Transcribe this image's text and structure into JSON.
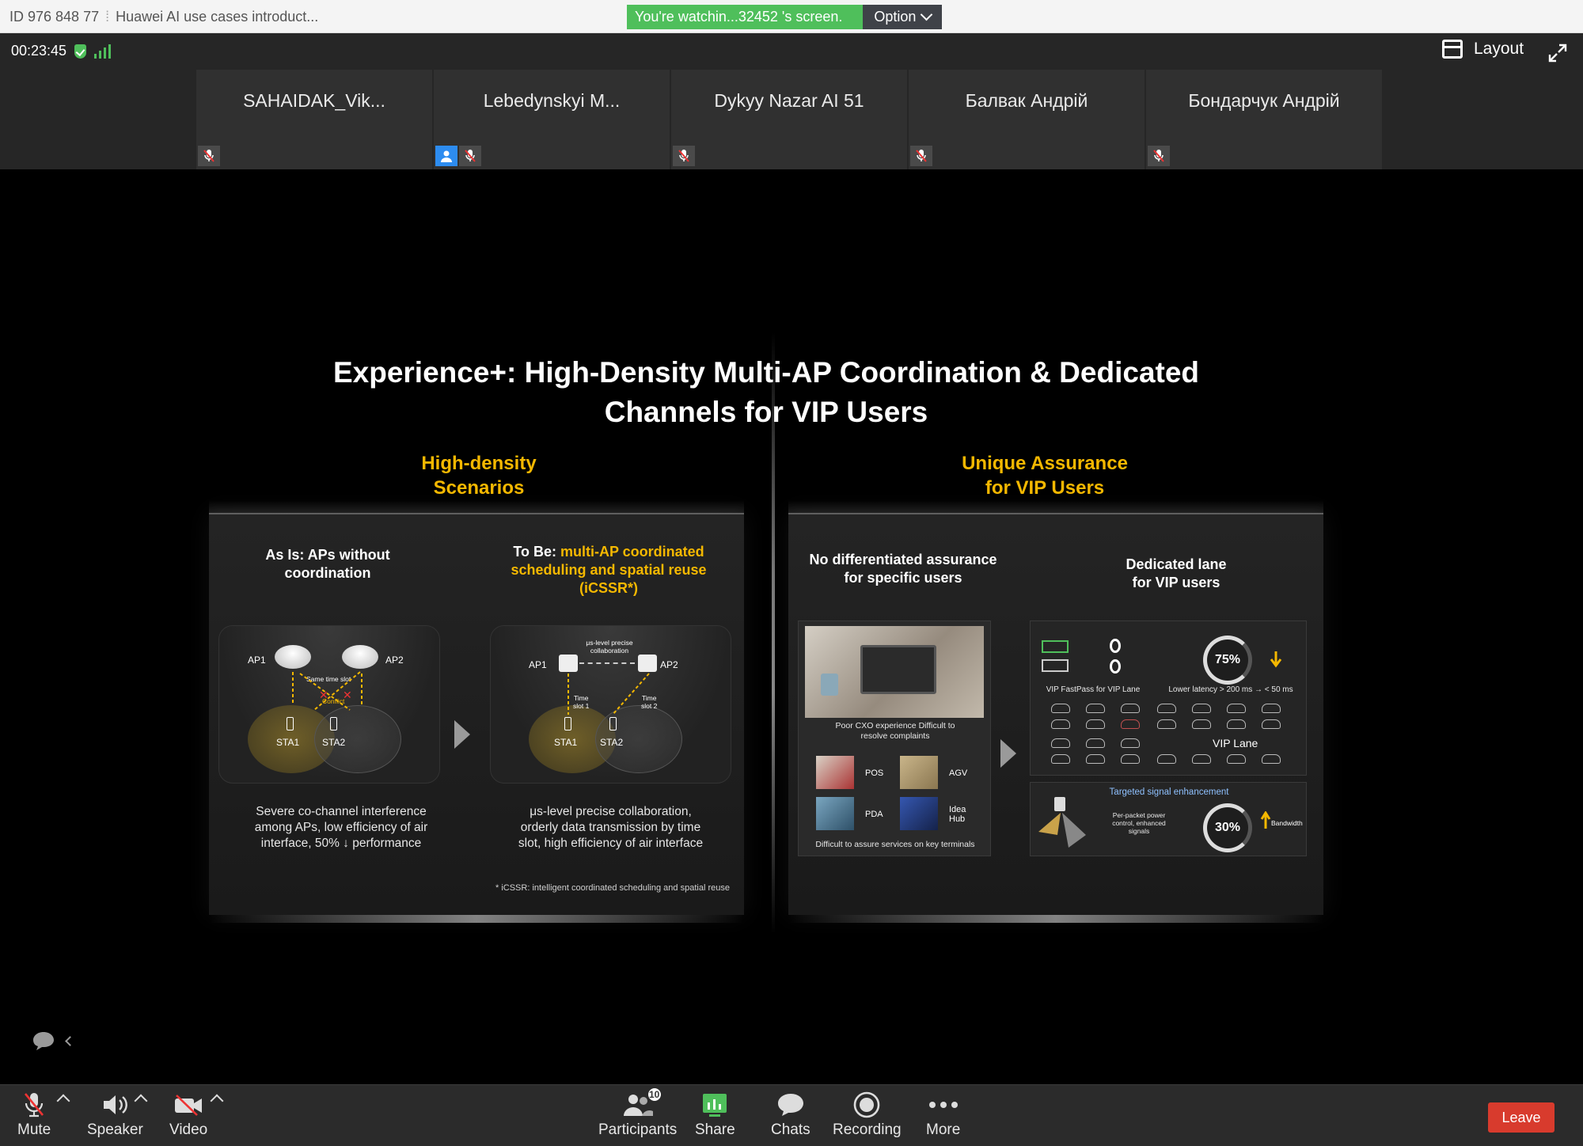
{
  "titlebar": {
    "meeting_id": "ID 976 848 77",
    "meeting_title": "Huawei AI use cases introduct...",
    "watching_message": "You're watchin...32452 's screen.",
    "option_label": "Option"
  },
  "status": {
    "timer": "00:23:45",
    "layout_label": "Layout"
  },
  "participants": [
    {
      "name": "SAHAIDAK_Vik...",
      "host": false
    },
    {
      "name": "Lebedynskyi M...",
      "host": true
    },
    {
      "name": "Dykyy Nazar AI 51",
      "host": false
    },
    {
      "name": "Балвак Андрій",
      "host": false
    },
    {
      "name": "Бондарчук Андрій",
      "host": false
    }
  ],
  "slide": {
    "title_line1": "Experience+: High-Density Multi-AP Coordination & Dedicated",
    "title_line2": "Channels for VIP Users",
    "left": {
      "head_line1": "High-density",
      "head_line2": "Scenarios",
      "asis_line1": "As Is: APs without",
      "asis_line2": "coordination",
      "tobe_prefix": "To Be: ",
      "tobe_line1": "multi-AP coordinated",
      "tobe_line2": "scheduling and spatial reuse",
      "tobe_line3": "(iCSSR*)",
      "diag1": {
        "ap1": "AP1",
        "ap2": "AP2",
        "sta1": "STA1",
        "sta2": "STA2",
        "note1": "Same time slot",
        "note2": "Conflict"
      },
      "diag2": {
        "ap1": "AP1",
        "ap2": "AP2",
        "sta1": "STA1",
        "sta2": "STA2",
        "top_note1": "μs-level precise",
        "top_note2": "collaboration",
        "slot1a": "Time",
        "slot1b": "slot 1",
        "slot2a": "Time",
        "slot2b": "slot 2"
      },
      "desc1_line1": "Severe co-channel interference",
      "desc1_line2": "among APs, low efficiency  of air",
      "desc1_line3": "interface, 50% ↓ performance",
      "desc2_line1": "μs-level precise collaboration,",
      "desc2_line2": "orderly data transmission by time",
      "desc2_line3": "slot, high efficiency of air interface",
      "footnote": "* iCSSR: intelligent coordinated scheduling and spatial reuse"
    },
    "right": {
      "head_line1": "Unique Assurance",
      "head_line2": "for VIP Users",
      "nodiff_line1": "No differentiated assurance",
      "nodiff_line2": "for specific users",
      "lane_line1": "Dedicated lane",
      "lane_line2": "for VIP users",
      "photo_caption1": "Poor CXO experience Difficult to",
      "photo_caption2": "resolve complaints",
      "terminals": [
        "POS",
        "AGV",
        "PDA",
        "Idea Hub"
      ],
      "terminals_caption": "Difficult to assure services on key terminals",
      "fastpass": "VIP FastPass for VIP Lane",
      "latency": "Lower latency > 200 ms → < 50 ms",
      "pct_lane": "75%",
      "vip_lane": "VIP Lane",
      "targeted": "Targeted signal enhancement",
      "per_packet_line1": "Per-packet power",
      "per_packet_line2": "control, enhanced",
      "per_packet_line3": "signals",
      "pct_signal": "30%",
      "bandwidth": "Bandwidth"
    }
  },
  "toolbar": {
    "mute": "Mute",
    "speaker": "Speaker",
    "video": "Video",
    "participants": "Participants",
    "participants_count": "10",
    "share": "Share",
    "chats": "Chats",
    "recording": "Recording",
    "more": "More",
    "leave": "Leave"
  },
  "colors": {
    "accent_green": "#4fbf5b",
    "slide_highlight": "#f5b800",
    "leave_red": "#d83b2d"
  }
}
